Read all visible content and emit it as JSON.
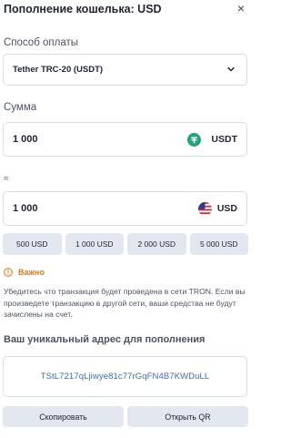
{
  "header": {
    "title": "Пополнение кошелька: USD"
  },
  "payment_method": {
    "label": "Способ оплаты",
    "selected": "Tether TRC-20 (USDT)"
  },
  "amount": {
    "label": "Сумма",
    "value": "1 000",
    "currency": "USDT",
    "icon": "tether-icon",
    "icon_color": "#26a17b"
  },
  "converted": {
    "symbol": "≈",
    "value": "1 000",
    "currency": "USD",
    "icon": "us-flag-icon"
  },
  "presets": [
    "500 USD",
    "1 000 USD",
    "2 000 USD",
    "5 000 USD"
  ],
  "warning": {
    "title": "Важно",
    "text": "Убедитесь что транзакция будет проведена в сети TRON. Если вы произведете транзакцию в другой сети, ваши средства не будут зачислены на счет.",
    "color": "#e07a1f"
  },
  "address": {
    "label": "Ваш уникальный адрес для пополнения",
    "value": "TStL7217qLjiwye81c77rGqFN4B7KWDuLL"
  },
  "actions": {
    "copy_label": "Скопировать",
    "qr_label": "Открыть QR"
  }
}
